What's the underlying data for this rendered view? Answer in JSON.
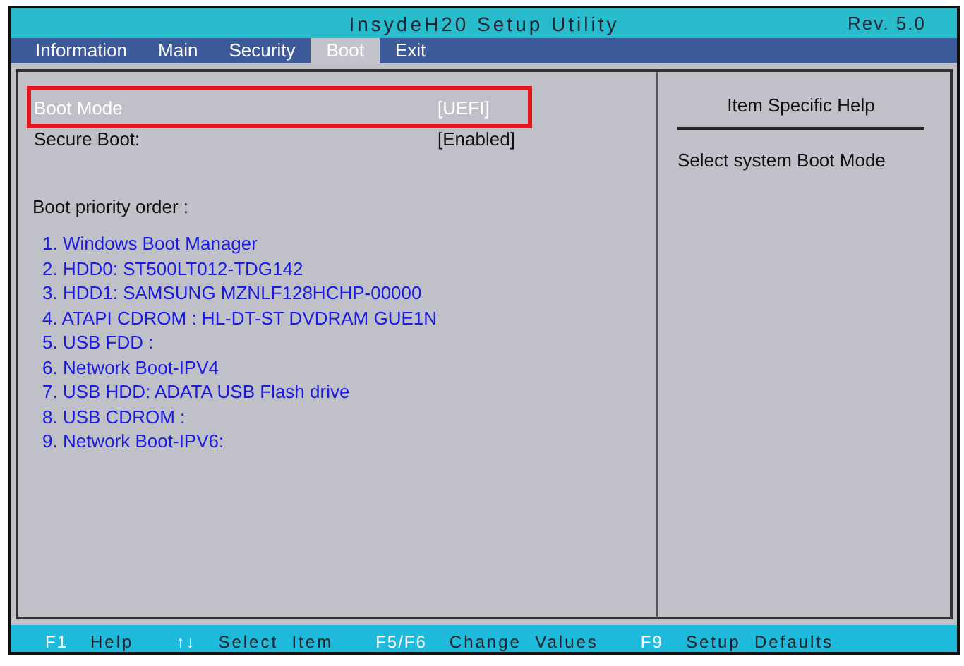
{
  "window": {
    "title": "InsydeH20 Setup Utility",
    "revision": "Rev. 5.0"
  },
  "tabs": [
    {
      "label": "Information",
      "selected": false
    },
    {
      "label": "Main",
      "selected": false
    },
    {
      "label": "Security",
      "selected": false
    },
    {
      "label": "Boot",
      "selected": true
    },
    {
      "label": "Exit",
      "selected": false
    }
  ],
  "settings": [
    {
      "label": "Boot Mode",
      "value": "[UEFI]",
      "selected": true,
      "highlighted": true
    },
    {
      "label": "Secure Boot:",
      "value": "[Enabled]",
      "selected": false,
      "highlighted": false
    }
  ],
  "boot_priority": {
    "heading": "Boot priority order :",
    "items": [
      "1. Windows Boot Manager",
      "2. HDD0: ST500LT012-TDG142",
      "3. HDD1: SAMSUNG MZNLF128HCHP-00000",
      "4. ATAPI CDROM : HL-DT-ST DVDRAM GUE1N",
      "5. USB FDD :",
      "6. Network Boot-IPV4",
      "7. USB HDD: ADATA USB Flash drive",
      "8. USB CDROM :",
      "9. Network Boot-IPV6:"
    ]
  },
  "help_panel": {
    "title": "Item Specific Help",
    "text": "Select system Boot Mode"
  },
  "status_bar": [
    {
      "key": "F1",
      "action": "Help"
    },
    {
      "key": "↑↓",
      "action": "Select  Item"
    },
    {
      "key": "F5/F6",
      "action": "Change  Values"
    },
    {
      "key": "F9",
      "action": "Setup  Defaults"
    }
  ]
}
